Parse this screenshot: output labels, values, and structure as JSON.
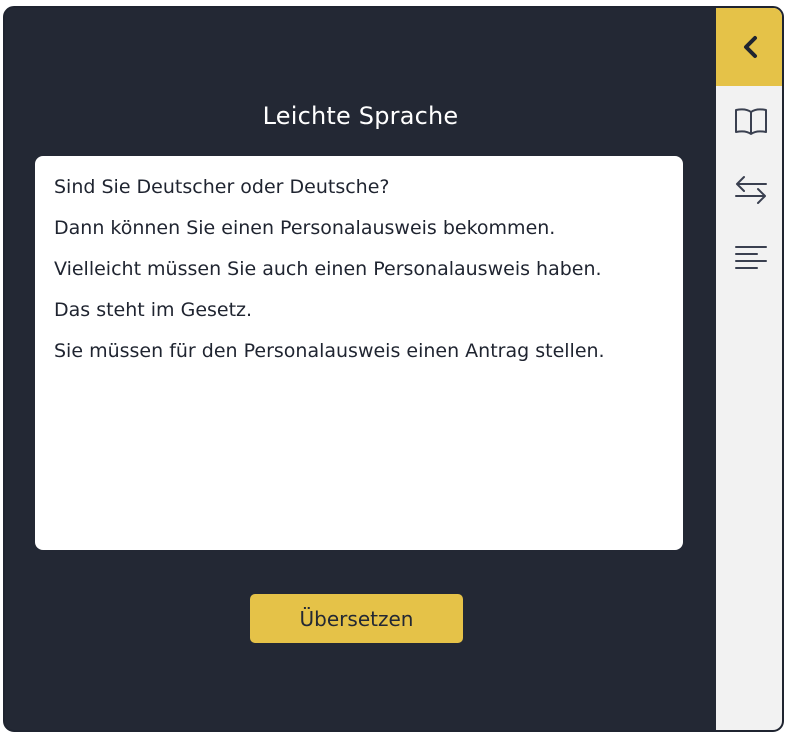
{
  "panel": {
    "title": "Leichte Sprache",
    "paragraphs": [
      "Sind Sie Deutscher oder Deutsche?",
      "Dann können Sie einen Personalausweis bekommen.",
      "Vielleicht müssen Sie auch einen Personalausweis haben.",
      "Das steht im Gesetz.",
      "Sie müssen für den Personalausweis einen Antrag stellen."
    ],
    "translate_label": "Übersetzen"
  },
  "sidebar": {
    "items": [
      {
        "icon": "chevron-left-icon"
      },
      {
        "icon": "book-icon"
      },
      {
        "icon": "swap-arrows-icon"
      },
      {
        "icon": "text-align-left-icon"
      }
    ]
  },
  "colors": {
    "background": "#232834",
    "accent": "#e5c248",
    "sidebar": "#f2f2f2",
    "text_panel": "#ffffff"
  }
}
